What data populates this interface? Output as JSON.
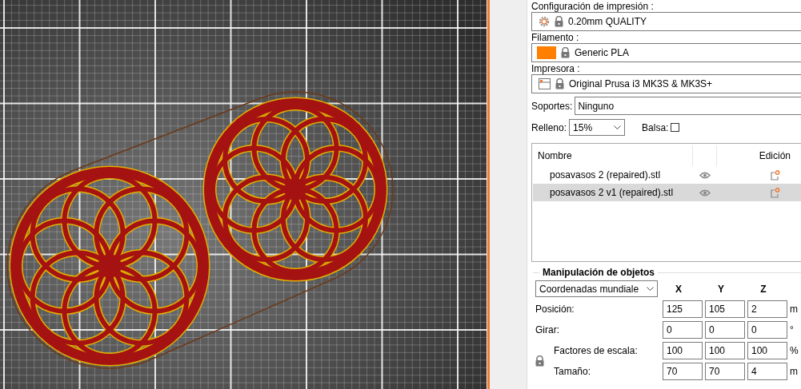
{
  "print_settings": {
    "label": "Configuración de impresión :",
    "value": "0.20mm QUALITY"
  },
  "filament": {
    "label": "Filamento :",
    "value": "Generic PLA"
  },
  "printer": {
    "label": "Impresora :",
    "value": "Original Prusa i3 MK3S & MK3S+"
  },
  "supports": {
    "label": "Soportes:",
    "value": "Ninguno"
  },
  "infill": {
    "label": "Relleno:",
    "value": "15%"
  },
  "brim": {
    "label": "Balsa:",
    "checked": false
  },
  "objects": {
    "columns": [
      "Nombre",
      "Edición"
    ],
    "rows": [
      {
        "name": "posavasos 2 (repaired).stl",
        "selected": false
      },
      {
        "name": "posavasos 2 v1 (repaired).stl",
        "selected": true
      }
    ]
  },
  "manipulation": {
    "title": "Manipulación de objetos",
    "coordinates": "Coordenadas mundiale",
    "axes": [
      "X",
      "Y",
      "Z"
    ],
    "rows": [
      {
        "label": "Posición:",
        "values": [
          "125",
          "105",
          "2"
        ],
        "unit": "m"
      },
      {
        "label": "Girar:",
        "values": [
          "0",
          "0",
          "0"
        ],
        "unit": "°"
      },
      {
        "label": "Factores de escala:",
        "values": [
          "100",
          "100",
          "100"
        ],
        "unit": "%"
      },
      {
        "label": "Tamaño:",
        "values": [
          "70",
          "70",
          "4"
        ],
        "unit": "m"
      }
    ]
  }
}
